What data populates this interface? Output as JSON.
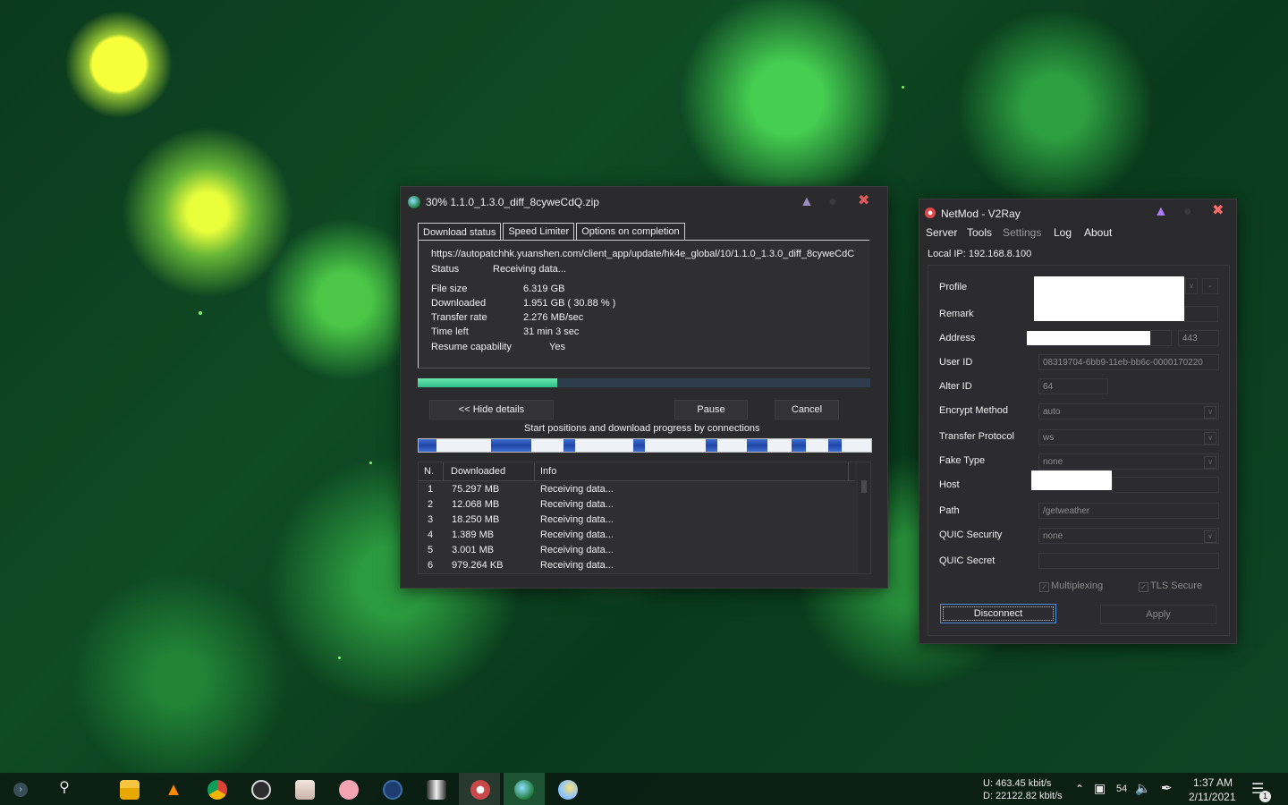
{
  "download_window": {
    "title": "30% 1.1.0_1.3.0_diff_8cyweCdQ.zip",
    "tabs": [
      "Download status",
      "Speed Limiter",
      "Options on completion"
    ],
    "url": "https://autopatchhk.yuanshen.com/client_app/update/hk4e_global/10/1.1.0_1.3.0_diff_8cyweCdC",
    "status_label": "Status",
    "status_value": "Receiving data...",
    "file_size_label": "File size",
    "file_size_value": "6.319  GB",
    "downloaded_label": "Downloaded",
    "downloaded_value": "1.951  GB  ( 30.88 % )",
    "rate_label": "Transfer rate",
    "rate_value": "2.276  MB/sec",
    "time_left_label": "Time left",
    "time_left_value": "31 min 3 sec",
    "resume_label": "Resume capability",
    "resume_value": "Yes",
    "progress_percent": 30.88,
    "hide_details_label": "<< Hide details",
    "pause_label": "Pause",
    "cancel_label": "Cancel",
    "connections_caption": "Start positions and download progress by connections",
    "connection_segments": [
      [
        0.0,
        0.04
      ],
      [
        0.16,
        0.25
      ],
      [
        0.32,
        0.345
      ],
      [
        0.475,
        0.5
      ],
      [
        0.635,
        0.66
      ],
      [
        0.725,
        0.77
      ],
      [
        0.825,
        0.855
      ],
      [
        0.905,
        0.935
      ]
    ],
    "table": {
      "headers": [
        "N.",
        "Downloaded",
        "Info"
      ],
      "rows": [
        {
          "n": "1",
          "downloaded": "75.297  MB",
          "info": "Receiving data..."
        },
        {
          "n": "2",
          "downloaded": "12.068  MB",
          "info": "Receiving data..."
        },
        {
          "n": "3",
          "downloaded": "18.250  MB",
          "info": "Receiving data..."
        },
        {
          "n": "4",
          "downloaded": "1.389  MB",
          "info": "Receiving data..."
        },
        {
          "n": "5",
          "downloaded": "3.001  MB",
          "info": "Receiving data..."
        },
        {
          "n": "6",
          "downloaded": "979.264  KB",
          "info": "Receiving data..."
        }
      ]
    }
  },
  "netmod_window": {
    "title": "NetMod - V2Ray",
    "menu": [
      "Server",
      "Tools",
      "Settings",
      "Log",
      "About"
    ],
    "local_ip": "Local IP: 192.168.8.100",
    "labels": {
      "profile": "Profile",
      "remark": "Remark",
      "address": "Address",
      "user_id": "User ID",
      "alter_id": "Alter ID",
      "encrypt": "Encrypt Method",
      "protocol": "Transfer Protocol",
      "fake_type": "Fake Type",
      "host": "Host",
      "path": "Path",
      "quic_security": "QUIC Security",
      "quic_secret": "QUIC Secret"
    },
    "values": {
      "port": "443",
      "user_id": "08319704-6bb9-11eb-bb6c-0000170220",
      "alter_id": "64",
      "encrypt": "auto",
      "protocol": "ws",
      "fake_type": "none",
      "path": "/getweather",
      "quic_security": "none",
      "profile_minus": "-"
    },
    "multiplexing_label": "Multiplexing",
    "tls_label": "TLS Secure",
    "disconnect_label": "Disconnect",
    "apply_label": "Apply"
  },
  "taskbar": {
    "upload": "U:      463.45 kbit/s",
    "download": "D:  22122.82 kbit/s",
    "network_badge": "54",
    "time": "1:37 AM",
    "date": "2/11/2021",
    "notification_count": "1",
    "active_color": "#2e7d4f"
  }
}
